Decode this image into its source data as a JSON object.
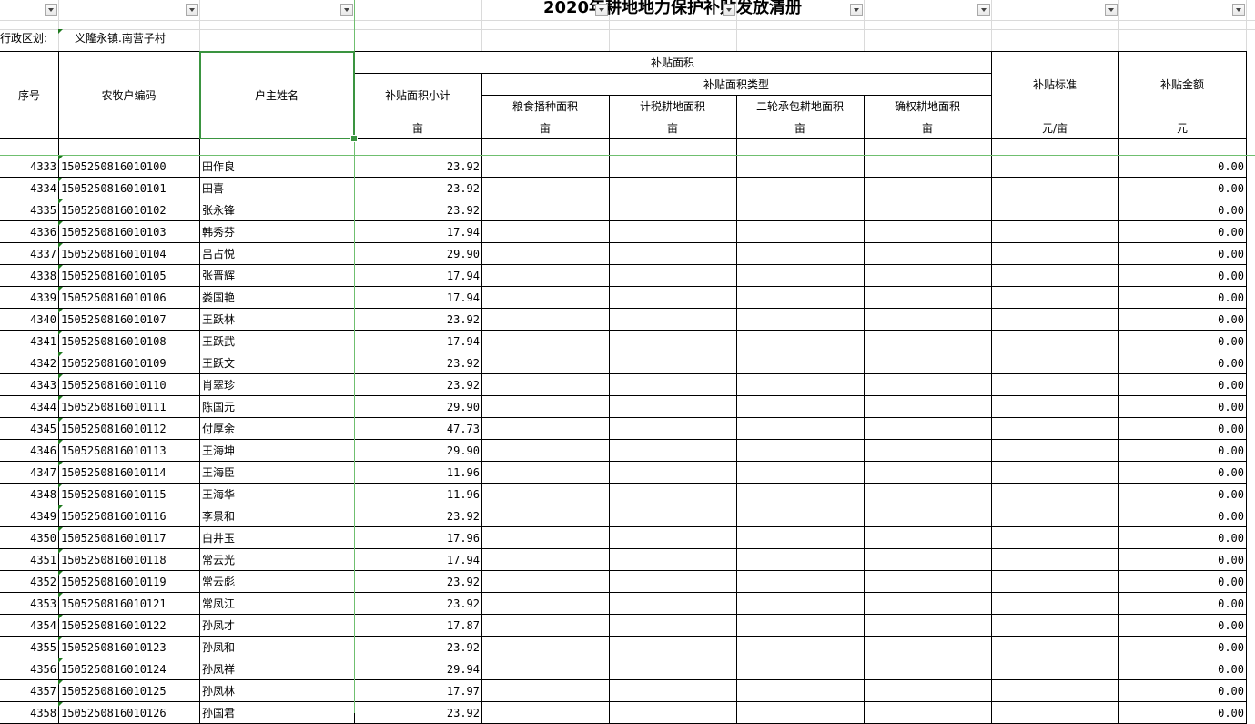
{
  "sheet": {
    "title": "2020年耕地地力保护补贴发放清册",
    "region_label": "行政区划:",
    "region_value": "义隆永镇.南营子村",
    "headers": {
      "seq": "序号",
      "code": "农牧户编码",
      "name": "户主姓名",
      "area_group": "补贴面积",
      "area_subtotal": "补贴面积小计",
      "area_types": "补贴面积类型",
      "grain_area": "粮食播种面积",
      "tax_area": "计税耕地面积",
      "contract_area": "二轮承包耕地面积",
      "confirmed_area": "确权耕地面积",
      "standard": "补贴标准",
      "amount": "补贴金额"
    },
    "units": {
      "area_subtotal": "亩",
      "grain_area": "亩",
      "tax_area": "亩",
      "contract_area": "亩",
      "confirmed_area": "亩",
      "standard": "元/亩",
      "amount": "元"
    },
    "rows": [
      {
        "seq": "4333",
        "code": "1505250816010100",
        "name": "田作良",
        "area": "23.92",
        "amount": "0.00"
      },
      {
        "seq": "4334",
        "code": "1505250816010101",
        "name": "田喜",
        "area": "23.92",
        "amount": "0.00"
      },
      {
        "seq": "4335",
        "code": "1505250816010102",
        "name": "张永锋",
        "area": "23.92",
        "amount": "0.00"
      },
      {
        "seq": "4336",
        "code": "1505250816010103",
        "name": "韩秀芬",
        "area": "17.94",
        "amount": "0.00"
      },
      {
        "seq": "4337",
        "code": "1505250816010104",
        "name": "吕占悦",
        "area": "29.90",
        "amount": "0.00"
      },
      {
        "seq": "4338",
        "code": "1505250816010105",
        "name": "张晋辉",
        "area": "17.94",
        "amount": "0.00"
      },
      {
        "seq": "4339",
        "code": "1505250816010106",
        "name": "娄国艳",
        "area": "17.94",
        "amount": "0.00"
      },
      {
        "seq": "4340",
        "code": "1505250816010107",
        "name": "王跃林",
        "area": "23.92",
        "amount": "0.00"
      },
      {
        "seq": "4341",
        "code": "1505250816010108",
        "name": "王跃武",
        "area": "17.94",
        "amount": "0.00"
      },
      {
        "seq": "4342",
        "code": "1505250816010109",
        "name": "王跃文",
        "area": "23.92",
        "amount": "0.00"
      },
      {
        "seq": "4343",
        "code": "1505250816010110",
        "name": "肖翠珍",
        "area": "23.92",
        "amount": "0.00"
      },
      {
        "seq": "4344",
        "code": "1505250816010111",
        "name": "陈国元",
        "area": "29.90",
        "amount": "0.00"
      },
      {
        "seq": "4345",
        "code": "1505250816010112",
        "name": "付厚余",
        "area": "47.73",
        "amount": "0.00"
      },
      {
        "seq": "4346",
        "code": "1505250816010113",
        "name": "王海坤",
        "area": "29.90",
        "amount": "0.00"
      },
      {
        "seq": "4347",
        "code": "1505250816010114",
        "name": "王海臣",
        "area": "11.96",
        "amount": "0.00"
      },
      {
        "seq": "4348",
        "code": "1505250816010115",
        "name": "王海华",
        "area": "11.96",
        "amount": "0.00"
      },
      {
        "seq": "4349",
        "code": "1505250816010116",
        "name": "李景和",
        "area": "23.92",
        "amount": "0.00"
      },
      {
        "seq": "4350",
        "code": "1505250816010117",
        "name": "白井玉",
        "area": "17.96",
        "amount": "0.00"
      },
      {
        "seq": "4351",
        "code": "1505250816010118",
        "name": "常云光",
        "area": "17.94",
        "amount": "0.00"
      },
      {
        "seq": "4352",
        "code": "1505250816010119",
        "name": "常云彪",
        "area": "23.92",
        "amount": "0.00"
      },
      {
        "seq": "4353",
        "code": "1505250816010121",
        "name": "常凤江",
        "area": "23.92",
        "amount": "0.00"
      },
      {
        "seq": "4354",
        "code": "1505250816010122",
        "name": "孙凤才",
        "area": "17.87",
        "amount": "0.00"
      },
      {
        "seq": "4355",
        "code": "1505250816010123",
        "name": "孙凤和",
        "area": "23.92",
        "amount": "0.00"
      },
      {
        "seq": "4356",
        "code": "1505250816010124",
        "name": "孙凤祥",
        "area": "29.94",
        "amount": "0.00"
      },
      {
        "seq": "4357",
        "code": "1505250816010125",
        "name": "孙凤林",
        "area": "17.97",
        "amount": "0.00"
      },
      {
        "seq": "4358",
        "code": "1505250816010126",
        "name": "孙国君",
        "area": "23.92",
        "amount": "0.00"
      }
    ]
  }
}
